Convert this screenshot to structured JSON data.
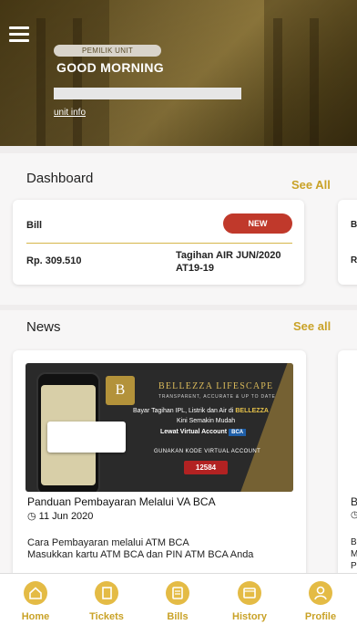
{
  "hero": {
    "owner_label": "PEMILIK UNIT",
    "greeting": "GOOD MORNING",
    "unit_info": "unit info"
  },
  "dashboard": {
    "title": "Dashboard",
    "see_all": "See All",
    "bill": {
      "label": "Bill",
      "status": "NEW",
      "amount": "Rp. 309.510",
      "description": "Tagihan AIR JUN/2020 AT19-19"
    },
    "peek": {
      "label": "B",
      "amount": "R"
    }
  },
  "news": {
    "title": "News",
    "see_all": "See all",
    "article": {
      "image": {
        "logo": "B",
        "heading": "BELLEZZA LIFESCAPE",
        "subheading": "TRANSPARENT, ACCURATE & UP TO DATE",
        "line1_prefix": "Bayar Tagihan IPL, Listrik dan Air di",
        "line1_brand": "BELLEZZA",
        "line2": "Kini Semakin Mudah",
        "line3": "Lewat Virtual Account",
        "bank": "BCA",
        "line4": "GUNAKAN KODE VIRTUAL ACCOUNT",
        "code": "12584"
      },
      "title": "Panduan Pembayaran Melalui VA BCA",
      "date": "11 Jun 2020",
      "body_line1": "Cara Pembayaran melalui ATM BCA",
      "body_line2": "Masukkan kartu ATM BCA dan PIN ATM BCA Anda"
    },
    "peek": {
      "title": "B",
      "clock": "◷",
      "l1": "B",
      "l2": "M",
      "l3": "P"
    }
  },
  "nav": {
    "home": "Home",
    "tickets": "Tickets",
    "bills": "Bills",
    "history": "History",
    "profile": "Profile"
  },
  "colors": {
    "accent": "#c9a227",
    "badge": "#c0392b"
  }
}
